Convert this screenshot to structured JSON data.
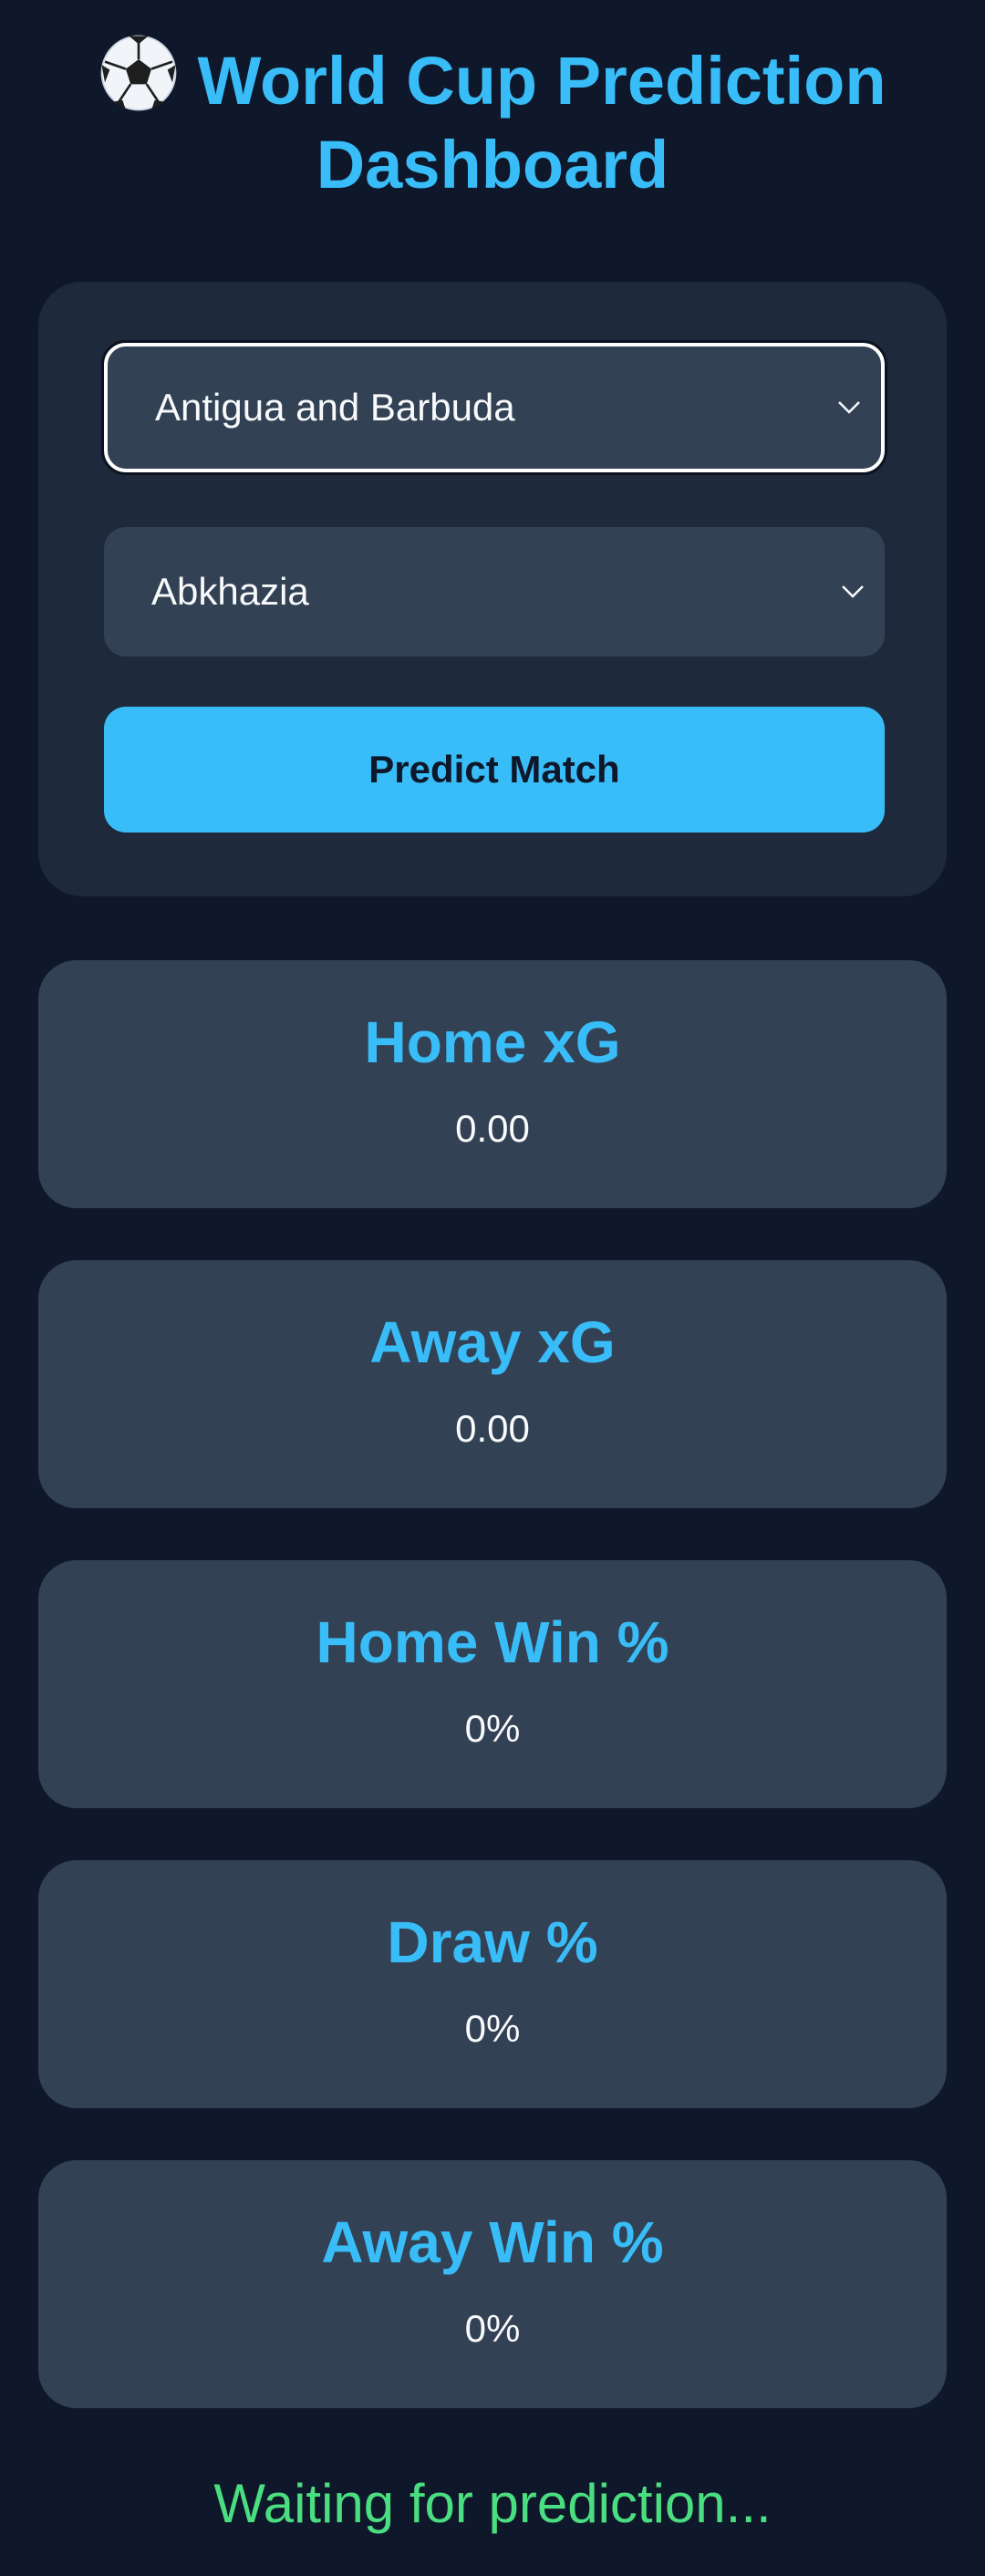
{
  "header": {
    "icon": "soccer-ball-icon",
    "title_line1": "World Cup Prediction",
    "title_line2": "Dashboard"
  },
  "form": {
    "home_team": "Antigua and Barbuda",
    "away_team": "Abkhazia",
    "predict_button": "Predict Match"
  },
  "stats": [
    {
      "label": "Home xG",
      "value": "0.00"
    },
    {
      "label": "Away xG",
      "value": "0.00"
    },
    {
      "label": "Home Win %",
      "value": "0%"
    },
    {
      "label": "Draw %",
      "value": "0%"
    },
    {
      "label": "Away Win %",
      "value": "0%"
    }
  ],
  "status": "Waiting for prediction...",
  "colors": {
    "background": "#0f172a",
    "panel": "#1e293b",
    "card": "#334155",
    "accent": "#38bdf8",
    "status": "#4ade80"
  }
}
